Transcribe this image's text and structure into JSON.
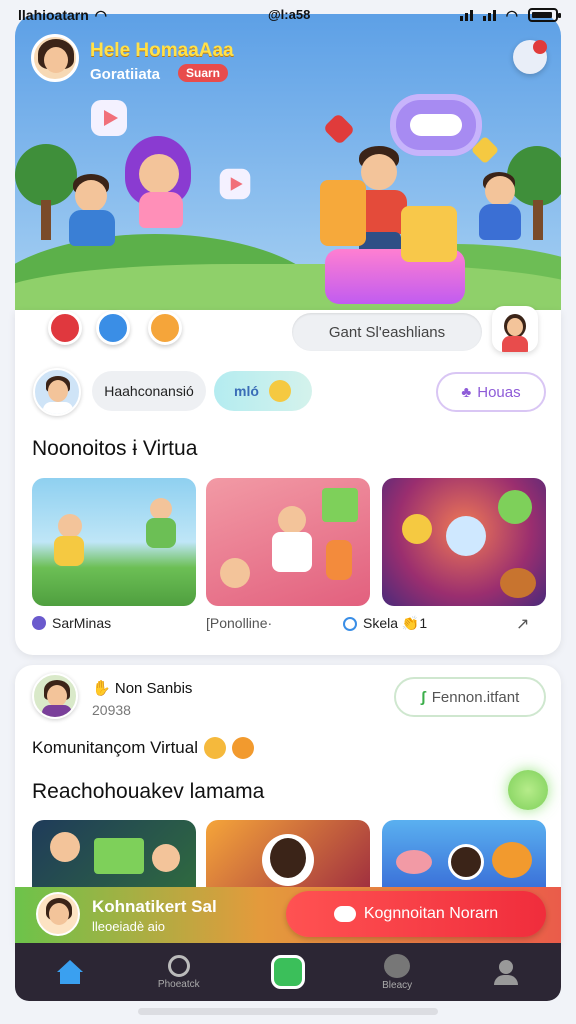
{
  "status_bar": {
    "carrier": "llahioatarn",
    "time": "@l:a58"
  },
  "hero": {
    "title": "Hele HomaaAaa",
    "subtitle": "Goratiiata",
    "badge": "Suarn"
  },
  "action_row": {
    "search_label": "Gant Sl'eashlians"
  },
  "profile_row": {
    "name_pill": "Haahconansió",
    "toggle_text": "mló",
    "button_label": "Houas"
  },
  "section1": {
    "title": "Noonoitos ɨ Virtua",
    "tiles": [
      {
        "caption": "SarMinas"
      },
      {
        "caption": "[Ponolline·"
      },
      {
        "caption": "Skela 👏1"
      }
    ]
  },
  "post": {
    "name": "Non Sanbis",
    "sub": "20938",
    "button_label": "Fennon.itfant",
    "text": "Komunitançom Virtual"
  },
  "section2": {
    "title": "Reachohouakev lamama"
  },
  "promo": {
    "title": "Kohnatikert Sal",
    "subtitle": "lleoeiadè aio",
    "button_label": "Kognnoitan Norarn"
  },
  "nav": {
    "items": [
      {
        "label": ""
      },
      {
        "label": "Phoeatck"
      },
      {
        "label": ""
      },
      {
        "label": "Bleacy"
      },
      {
        "label": ""
      }
    ]
  },
  "colors": {
    "accent": "#f02d3c",
    "nav_bg": "#2c2634",
    "sky": "#5da0e6"
  }
}
